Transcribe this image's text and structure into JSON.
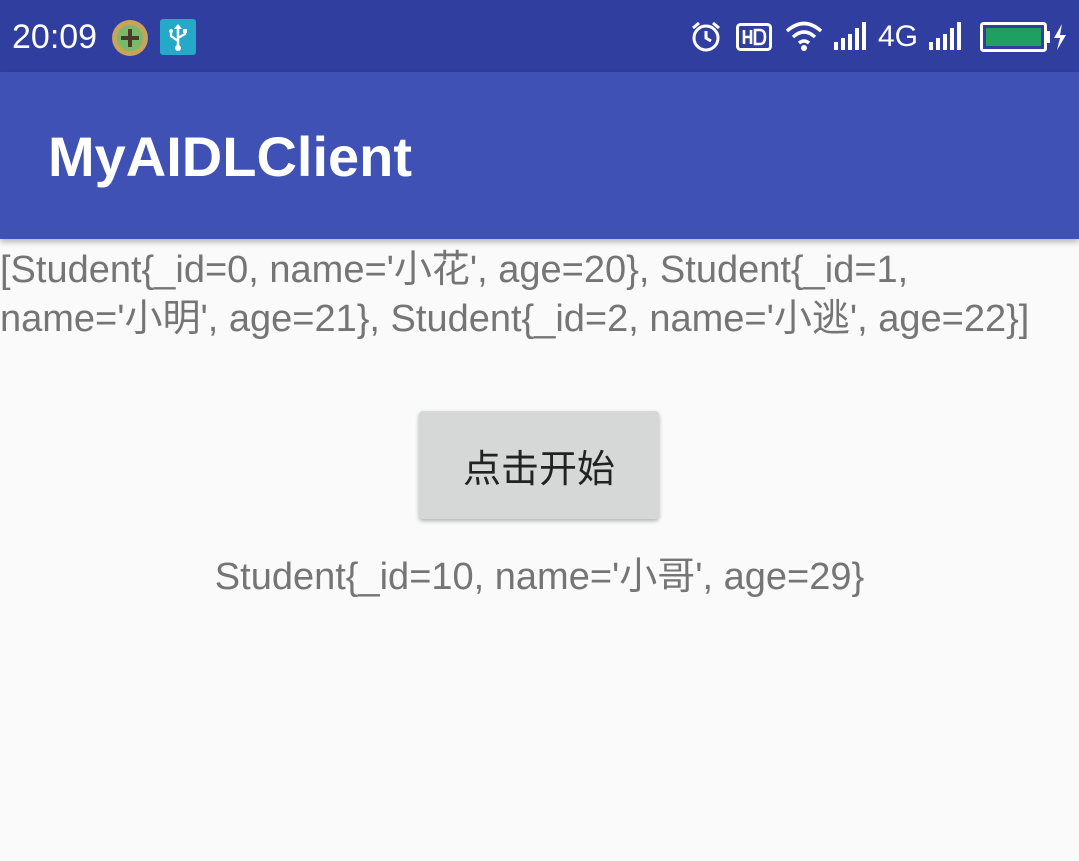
{
  "status_bar": {
    "time": "20:09",
    "network": "4G",
    "icons": [
      "app-notification-icon",
      "usb-icon",
      "alarm-icon",
      "hd-icon",
      "wifi-icon",
      "signal-icon",
      "signal-icon-2",
      "battery-charging-icon"
    ]
  },
  "app_bar": {
    "title": "MyAIDLClient"
  },
  "main": {
    "student_list_text": "[Student{_id=0, name='小花', age=20}, Student{_id=1, name='小明', age=21}, Student{_id=2, name='小逃', age=22}]",
    "start_button_label": "点击开始",
    "result_text": "Student{_id=10, name='小哥', age=29}"
  },
  "colors": {
    "status_bar": "#303f9f",
    "app_bar": "#3f51b5",
    "background": "#fafafa",
    "battery_fill": "#20a060"
  }
}
